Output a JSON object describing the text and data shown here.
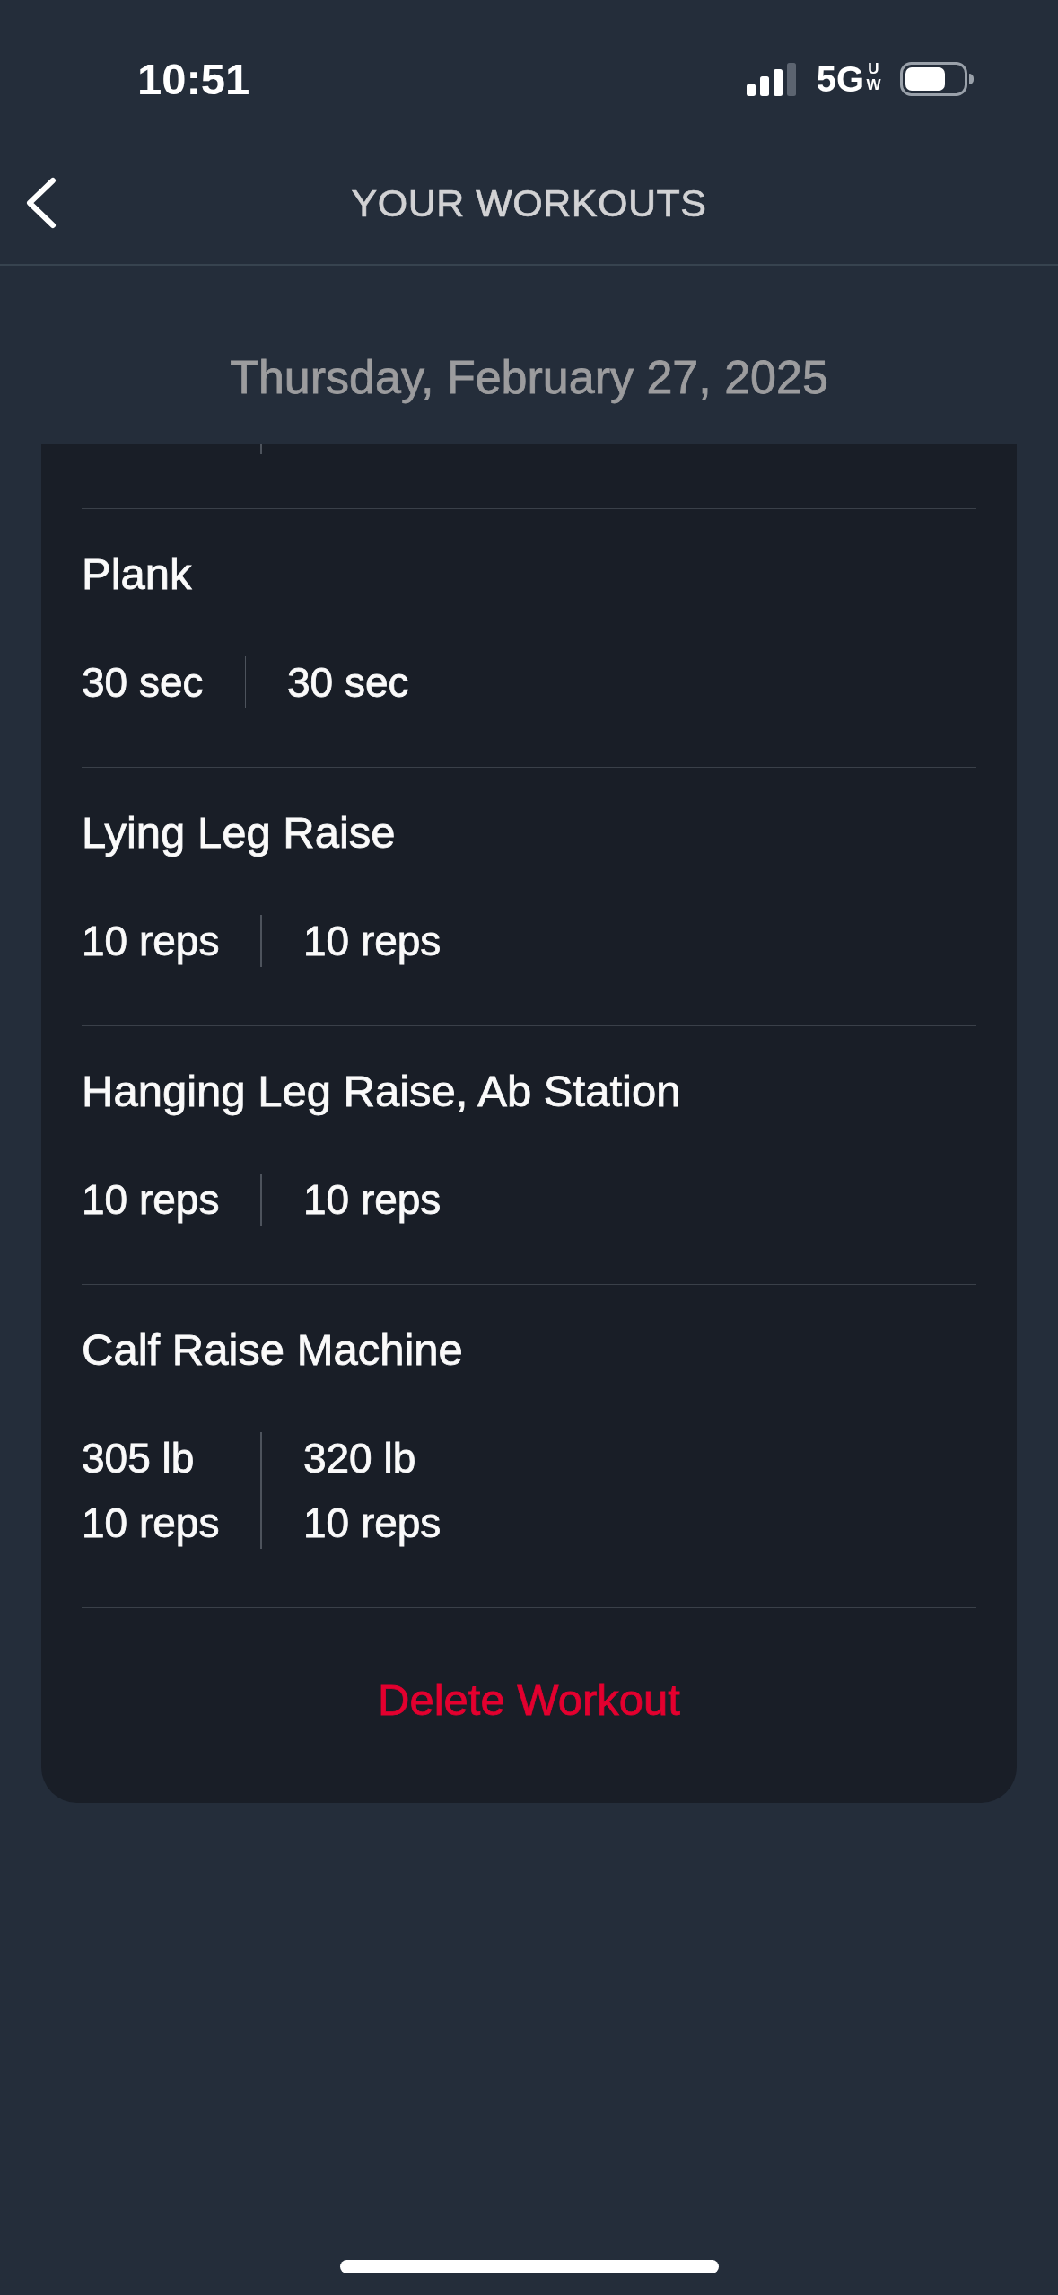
{
  "status_bar": {
    "time": "10:51",
    "network": "5G",
    "network_badge": "UW"
  },
  "header": {
    "title": "YOUR WORKOUTS"
  },
  "date": "Thursday, February 27, 2025",
  "exercises": [
    {
      "name": "Plank",
      "sets": [
        [
          "30 sec"
        ],
        [
          "30 sec"
        ]
      ]
    },
    {
      "name": "Lying Leg Raise",
      "sets": [
        [
          "10 reps"
        ],
        [
          "10 reps"
        ]
      ]
    },
    {
      "name": "Hanging Leg Raise, Ab Station",
      "sets": [
        [
          "10 reps"
        ],
        [
          "10 reps"
        ]
      ]
    },
    {
      "name": "Calf Raise Machine",
      "sets": [
        [
          "305 lb",
          "10 reps"
        ],
        [
          "320 lb",
          "10 reps"
        ]
      ]
    }
  ],
  "delete_button": "Delete Workout"
}
